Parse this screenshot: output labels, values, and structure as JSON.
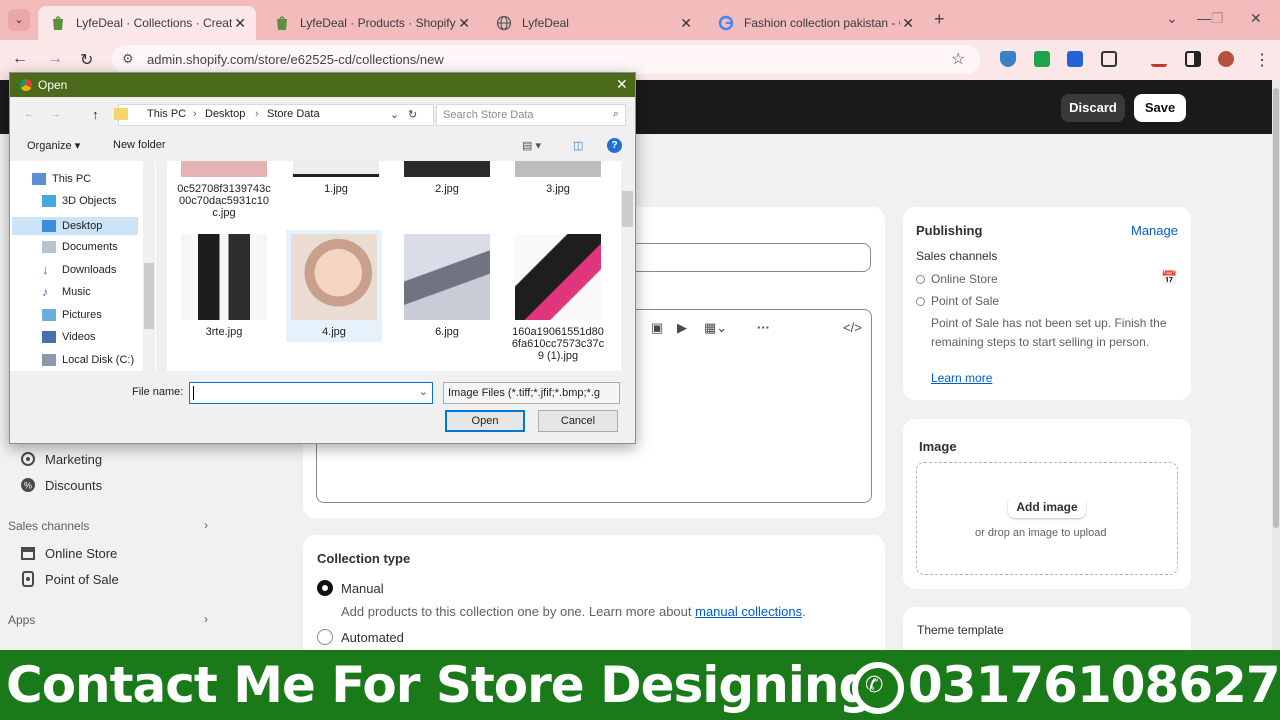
{
  "browser": {
    "tabs": [
      {
        "label": "LyfeDeal · Collections · Create c",
        "active": true
      },
      {
        "label": "LyfeDeal · Products · Shopify",
        "active": false
      },
      {
        "label": "LyfeDeal",
        "active": false
      },
      {
        "label": "Fashion collection pakistan - Go",
        "active": false
      }
    ],
    "url": "admin.shopify.com/store/e62525-cd/collections/new"
  },
  "admin": {
    "discard_label": "Discard",
    "save_label": "Save",
    "sidebar": {
      "marketing": "Marketing",
      "discounts": "Discounts",
      "sales_channels_heading": "Sales channels",
      "online_store": "Online Store",
      "point_of_sale": "Point of Sale",
      "apps_heading": "Apps"
    },
    "publishing": {
      "title": "Publishing",
      "manage": "Manage",
      "sales_channels": "Sales channels",
      "online_store": "Online Store",
      "point_of_sale": "Point of Sale",
      "pos_note": "Point of Sale has not been set up. Finish the remaining steps to start selling in person.",
      "learn_more": "Learn more"
    },
    "image": {
      "title": "Image",
      "add_image": "Add image",
      "drop_hint": "or drop an image to upload"
    },
    "theme_template": "Theme template",
    "collection_type": {
      "title": "Collection type",
      "manual": "Manual",
      "manual_desc": "Add products to this collection one by one. Learn more about ",
      "manual_link": "manual collections",
      "manual_end": ".",
      "automated": "Automated"
    }
  },
  "dialog": {
    "title": "Open",
    "breadcrumb": [
      "This PC",
      "Desktop",
      "Store Data"
    ],
    "search_placeholder": "Search Store Data",
    "organize": "Organize",
    "new_folder": "New folder",
    "nav": [
      "This PC",
      "3D Objects",
      "Desktop",
      "Documents",
      "Downloads",
      "Music",
      "Pictures",
      "Videos",
      "Local Disk (C:)"
    ],
    "files_top": [
      "0c52708f3139743c00c70dac5931c10c.jpg",
      "1.jpg",
      "2.jpg",
      "3.jpg"
    ],
    "files": [
      "3rte.jpg",
      "4.jpg",
      "6.jpg",
      "160a19061551d806fa610cc7573c37c9 (1).jpg"
    ],
    "file_name_label": "File name:",
    "file_name_value": "",
    "file_type": "Image Files (*.tiff;*.jfif;*.bmp;*.g",
    "open_button": "Open",
    "cancel_button": "Cancel"
  },
  "banner": {
    "text": "Contact Me For Store Designing",
    "phone": "03176108627"
  }
}
